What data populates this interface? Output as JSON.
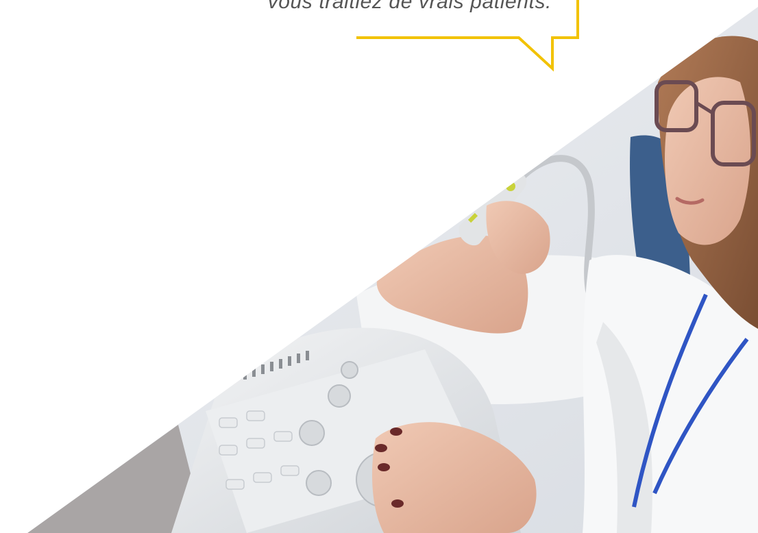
{
  "testimonial": {
    "quote_fragment": "vous traitiez de vrais patients.",
    "accent_color": "#f2c200"
  },
  "photo": {
    "subject": "medical-ultrasound-scene",
    "background_color": "#ffffff"
  }
}
